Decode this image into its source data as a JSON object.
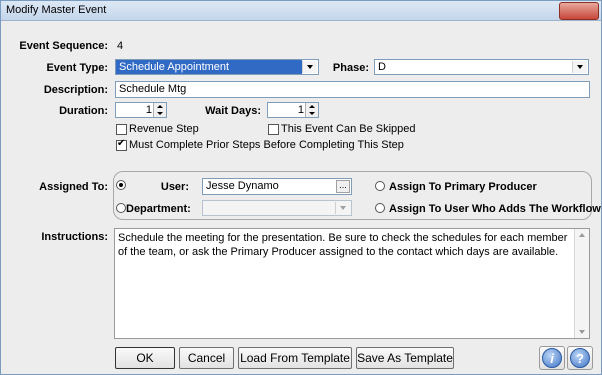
{
  "window": {
    "title": "Modify Master Event"
  },
  "event_sequence": {
    "label": "Event Sequence:",
    "value": "4"
  },
  "event_type": {
    "label": "Event Type:",
    "value": "Schedule Appointment"
  },
  "phase": {
    "label": "Phase:",
    "value": "D"
  },
  "description": {
    "label": "Description:",
    "value": "Schedule Mtg"
  },
  "duration": {
    "label": "Duration:",
    "value": "1"
  },
  "wait_days": {
    "label": "Wait Days:",
    "value": "1"
  },
  "options": {
    "revenue_step": {
      "label": "Revenue Step",
      "checked": false
    },
    "can_be_skipped": {
      "label": "This Event Can Be Skipped",
      "checked": false
    },
    "must_complete_prior": {
      "label": "Must Complete Prior Steps Before Completing This Step",
      "checked": true
    }
  },
  "assigned_to": {
    "label": "Assigned To:",
    "user_label": "User:",
    "user_value": "Jesse Dynamo",
    "browse_label": "...",
    "department_label": "Department:",
    "department_value": "",
    "primary_producer_label": "Assign To Primary Producer",
    "workflow_user_label": "Assign To User Who Adds The Workflow",
    "selected": "user"
  },
  "instructions": {
    "label": "Instructions:",
    "text": "Schedule the meeting for the presentation.  Be sure to check the schedules for each member of the team, or ask the Primary Producer assigned to the contact which days are available."
  },
  "buttons": {
    "ok": "OK",
    "cancel": "Cancel",
    "load_template": "Load From Template",
    "save_template": "Save As Template",
    "info_glyph": "i",
    "help_glyph": "?"
  },
  "icons": {
    "info": "info-icon",
    "help": "help-icon"
  },
  "colors": {
    "selection": "#316ac5",
    "title_bar": "#c4d6ec",
    "help_button": "#3f74c6"
  }
}
